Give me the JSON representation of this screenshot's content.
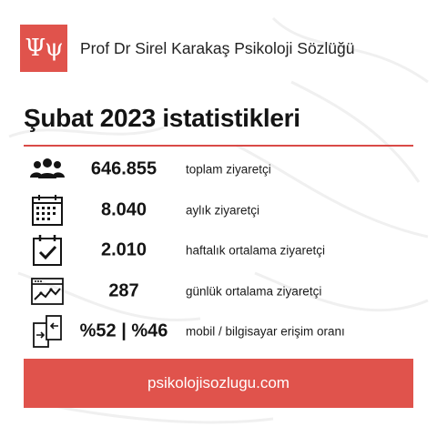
{
  "header": {
    "logo_text": "Ψψ",
    "site_name": "Prof Dr Sirel Karakaş Psikoloji Sözlüğü"
  },
  "title": "Şubat 2023 istatistikleri",
  "stats": [
    {
      "icon": "users-icon",
      "value": "646.855",
      "label": "toplam ziyaretçi"
    },
    {
      "icon": "calendar-icon",
      "value": "8.040",
      "label": "aylık ziyaretçi"
    },
    {
      "icon": "calendar-check-icon",
      "value": "2.010",
      "label": "haftalık ortalama ziyaretçi"
    },
    {
      "icon": "chart-window-icon",
      "value": "287",
      "label": "günlük ortalama ziyaretçi"
    },
    {
      "icon": "devices-transfer-icon",
      "value": "%52 | %46",
      "label": "mobil / bilgisayar erişim oranı"
    }
  ],
  "footer": {
    "url": "psikolojisozlugu.com"
  },
  "colors": {
    "accent": "#e0534c",
    "divider": "#d94a47",
    "text": "#141414"
  }
}
